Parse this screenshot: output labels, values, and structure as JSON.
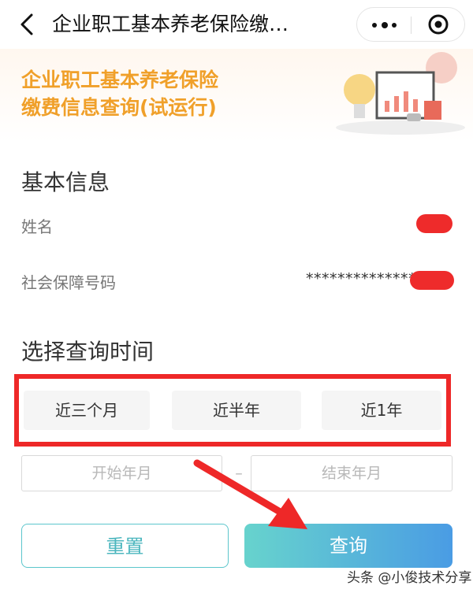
{
  "nav": {
    "title": "企业职工基本养老保险缴…",
    "back_icon": "chevron-left-icon",
    "more_icon": "more-dots-icon",
    "close_icon": "target-close-icon"
  },
  "banner": {
    "title_line1": "企业职工基本养老保险",
    "title_line2": "缴费信息查询(试运行)",
    "accent_color": "#f0a02a"
  },
  "basic_info": {
    "heading": "基本信息",
    "name_label": "姓名",
    "ssn_label": "社会保障号码",
    "ssn_value": "***************"
  },
  "query_time": {
    "heading": "选择查询时间",
    "options": [
      "近三个月",
      "近半年",
      "近1年"
    ],
    "start_placeholder": "开始年月",
    "separator": "–",
    "end_placeholder": "结束年月"
  },
  "actions": {
    "reset_label": "重置",
    "query_label": "查询"
  },
  "watermark": "头条 @小俊技术分享",
  "colors": {
    "annotation_red": "#ee2828",
    "button_gradient_start": "#67d3cd",
    "button_gradient_end": "#4a9ce4"
  }
}
